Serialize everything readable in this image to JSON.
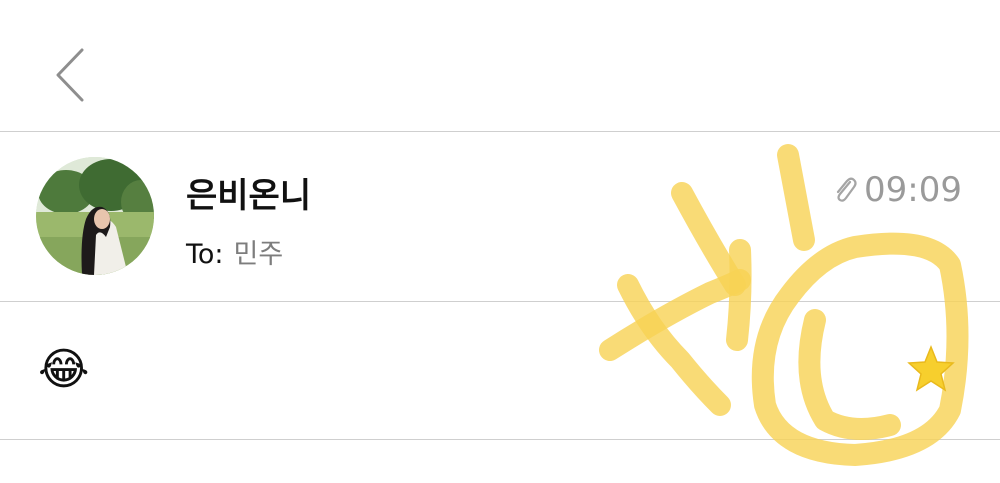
{
  "header": {
    "back_icon": "chevron-left-icon"
  },
  "message": {
    "sender_name": "은비온니",
    "to_label": "To:",
    "recipient": "민주",
    "attachment_icon": "paperclip-icon",
    "time": "09:09",
    "body": "😂"
  },
  "decorations": {
    "doodle_text": "사랑",
    "doodle_color": "#f8d254",
    "sticker": "star-icon",
    "sticker_color": "#f7cf2d"
  },
  "colors": {
    "divider": "#cfcfcf",
    "muted_text": "#9a9a9a"
  }
}
